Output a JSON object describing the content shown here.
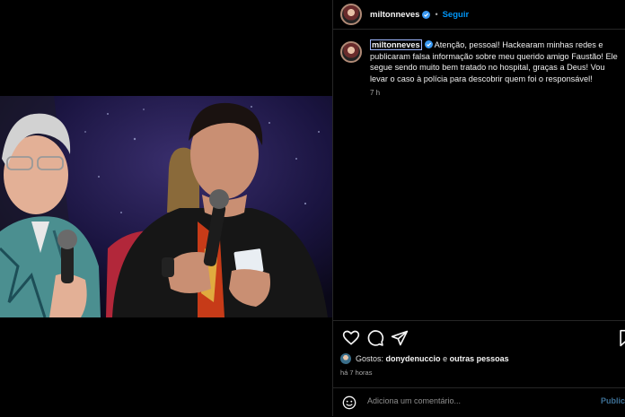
{
  "post": {
    "username": "miltonneves",
    "follow_label": "Seguir",
    "separator": "•"
  },
  "caption": {
    "username": "miltonneves",
    "text": "Atenção, pessoal! Hackearam minhas redes e publicaram falsa informação sobre meu querido amigo Faustão! Ele segue sendo muito bem tratado no hospital, graças a Deus! Vou levar o caso à polícia para descobrir quem foi o responsável!",
    "time": "7 h"
  },
  "likes": {
    "prefix": "Gostos:",
    "user": "donydenuccio",
    "connector": "e",
    "others": "outras pessoas"
  },
  "timestamp": "há 7 horas",
  "comment": {
    "placeholder": "Adiciona um comentário...",
    "publish_label": "Publicar"
  },
  "colors": {
    "accent": "#0095f6",
    "verified": "#3897f0",
    "background": "#000000"
  },
  "icons": [
    "verified-icon",
    "heart-icon",
    "comment-icon",
    "share-icon",
    "save-icon",
    "emoji-icon"
  ]
}
